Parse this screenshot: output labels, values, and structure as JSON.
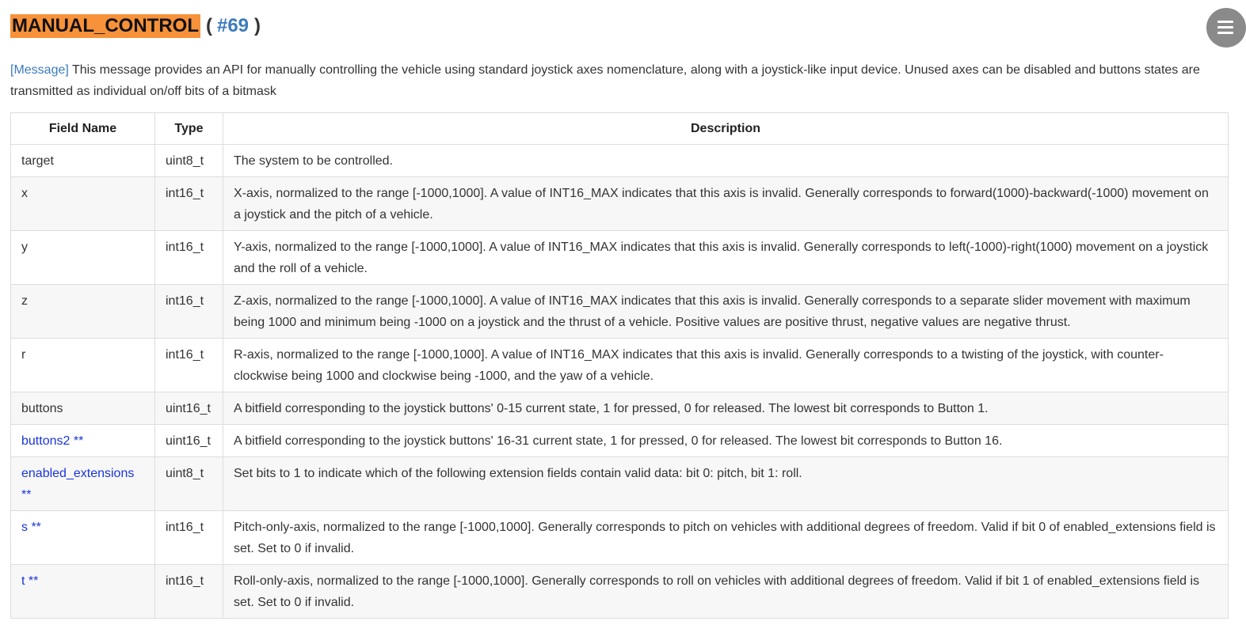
{
  "title": {
    "name": "MANUAL_CONTROL",
    "paren_open": "(",
    "id": "#69",
    "paren_close": ")"
  },
  "intro": {
    "tag": "[Message]",
    "text": "This message provides an API for manually controlling the vehicle using standard joystick axes nomenclature, along with a joystick-like input device. Unused axes can be disabled and buttons states are transmitted as individual on/off bits of a bitmask"
  },
  "table": {
    "headers": [
      "Field Name",
      "Type",
      "Description"
    ],
    "rows": [
      {
        "field": "target",
        "ext": "",
        "type": "uint8_t",
        "description": "The system to be controlled."
      },
      {
        "field": "x",
        "ext": "",
        "type": "int16_t",
        "description": "X-axis, normalized to the range [-1000,1000]. A value of INT16_MAX indicates that this axis is invalid. Generally corresponds to forward(1000)-backward(-1000) movement on a joystick and the pitch of a vehicle."
      },
      {
        "field": "y",
        "ext": "",
        "type": "int16_t",
        "description": "Y-axis, normalized to the range [-1000,1000]. A value of INT16_MAX indicates that this axis is invalid. Generally corresponds to left(-1000)-right(1000) movement on a joystick and the roll of a vehicle."
      },
      {
        "field": "z",
        "ext": "",
        "type": "int16_t",
        "description": "Z-axis, normalized to the range [-1000,1000]. A value of INT16_MAX indicates that this axis is invalid. Generally corresponds to a separate slider movement with maximum being 1000 and minimum being -1000 on a joystick and the thrust of a vehicle. Positive values are positive thrust, negative values are negative thrust."
      },
      {
        "field": "r",
        "ext": "",
        "type": "int16_t",
        "description": "R-axis, normalized to the range [-1000,1000]. A value of INT16_MAX indicates that this axis is invalid. Generally corresponds to a twisting of the joystick, with counter-clockwise being 1000 and clockwise being -1000, and the yaw of a vehicle."
      },
      {
        "field": "buttons",
        "ext": "",
        "type": "uint16_t",
        "description": "A bitfield corresponding to the joystick buttons' 0-15 current state, 1 for pressed, 0 for released. The lowest bit corresponds to Button 1."
      },
      {
        "field": "buttons2",
        "ext": "**",
        "type": "uint16_t",
        "description": "A bitfield corresponding to the joystick buttons' 16-31 current state, 1 for pressed, 0 for released. The lowest bit corresponds to Button 16."
      },
      {
        "field": "enabled_extensions",
        "ext": "**",
        "type": "uint8_t",
        "description": "Set bits to 1 to indicate which of the following extension fields contain valid data: bit 0: pitch, bit 1: roll."
      },
      {
        "field": "s",
        "ext": "**",
        "type": "int16_t",
        "description": "Pitch-only-axis, normalized to the range [-1000,1000]. Generally corresponds to pitch on vehicles with additional degrees of freedom. Valid if bit 0 of enabled_extensions field is set. Set to 0 if invalid."
      },
      {
        "field": "t",
        "ext": "**",
        "type": "int16_t",
        "description": "Roll-only-axis, normalized to the range [-1000,1000]. Generally corresponds to roll on vehicles with additional degrees of freedom. Valid if bit 1 of enabled_extensions field is set. Set to 0 if invalid."
      }
    ]
  },
  "menu_icon": "hamburger-icon"
}
